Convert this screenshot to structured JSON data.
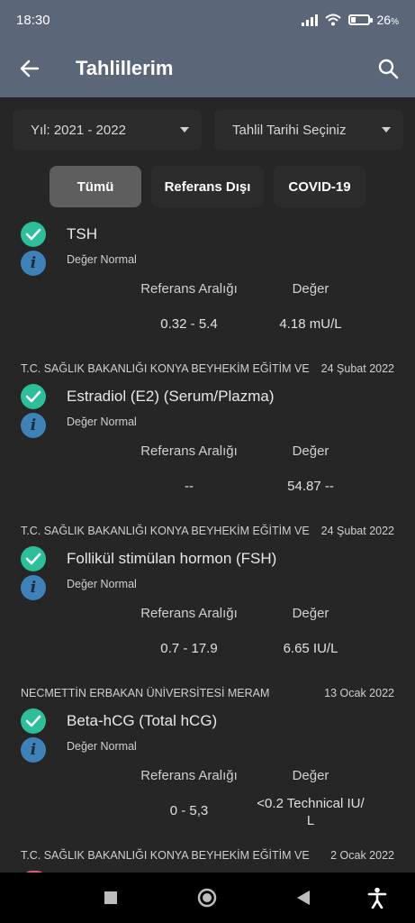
{
  "status_bar": {
    "time": "18:30",
    "battery_text": "26",
    "battery_suffix": "%",
    "battery_level": 0.26
  },
  "app_bar": {
    "title": "Tahlillerim"
  },
  "filters": {
    "year": "Yıl: 2021 - 2022",
    "date": "Tahlil Tarihi Seçiniz"
  },
  "tabs": [
    {
      "label": "Tümü",
      "active": true
    },
    {
      "label": "Referans Dışı",
      "active": false
    },
    {
      "label": "COVID-19",
      "active": false
    }
  ],
  "results": [
    {
      "institution": "",
      "date": "",
      "name": "TSH",
      "status": "Değer Normal",
      "ref_label": "Referans Aralığı",
      "val_label": "Değer",
      "ref": "0.32 - 5.4",
      "value": "4.18 mU/L"
    },
    {
      "institution": "T.C. SAĞLIK BAKANLIĞI KONYA BEYHEKİM EĞİTİM VE",
      "date": "24 Şubat 2022",
      "name": "Estradiol (E2) (Serum/Plazma)",
      "status": "Değer Normal",
      "ref_label": "Referans Aralığı",
      "val_label": "Değer",
      "ref": "--",
      "value": "54.87 --"
    },
    {
      "institution": "T.C. SAĞLIK BAKANLIĞI KONYA BEYHEKİM EĞİTİM VE",
      "date": "24 Şubat 2022",
      "name": "Follikül stimülan hormon (FSH)",
      "status": "Değer Normal",
      "ref_label": "Referans Aralığı",
      "val_label": "Değer",
      "ref": "0.7 - 17.9",
      "value": "6.65 IU/L"
    },
    {
      "institution": "NECMETTİN ERBAKAN ÜNİVERSİTESİ MERAM",
      "date": "13 Ocak 2022",
      "name": "Beta-hCG (Total hCG)",
      "status": "Değer Normal",
      "ref_label": "Referans Aralığı",
      "val_label": "Değer",
      "ref": "0 - 5,3",
      "value_line1": "<0.2 Technical IU/",
      "value_line2": "L"
    },
    {
      "institution": "T.C. SAĞLIK BAKANLIĞI KONYA BEYHEKİM EĞİTİM VE",
      "date": "2 Ocak 2022"
    }
  ],
  "colors": {
    "app_bar": "#5c6679",
    "background": "#262626",
    "check": "#2dbf9a",
    "info": "#3f82ba",
    "flag": "#e25a7d"
  },
  "icons": {
    "back": "arrow-left-icon",
    "search": "search-icon",
    "check": "check-icon",
    "info": "info-icon"
  }
}
